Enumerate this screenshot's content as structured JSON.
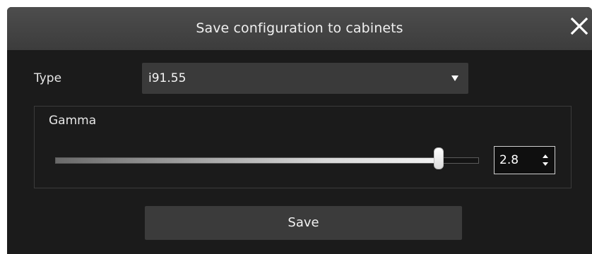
{
  "window": {
    "title": "Save configuration to cabinets",
    "close_icon": "close-icon"
  },
  "type_field": {
    "label": "Type",
    "selected_value": "i91.55",
    "dropdown_icon": "chevron-down-icon"
  },
  "gamma": {
    "group_label": "Gamma",
    "value": "2.8",
    "slider_fraction": 0.905
  },
  "actions": {
    "save_label": "Save"
  },
  "colors": {
    "dialog_background": "#1b1b1b",
    "titlebar": "#444444",
    "control_background": "#3a3a3a",
    "text": "#f0f0f0"
  }
}
